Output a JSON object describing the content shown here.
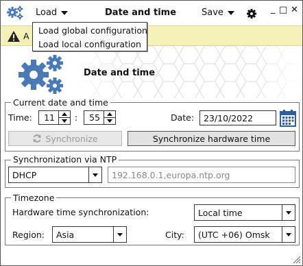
{
  "toolbar": {
    "load_label": "Load",
    "title": "Date and time",
    "save_label": "Save",
    "minimize": "_",
    "maximize": "□",
    "close": "✕"
  },
  "load_menu": {
    "items": [
      "Load global configuration",
      "Load local configuration"
    ]
  },
  "notification": {
    "visible_text": "A"
  },
  "banner": {
    "title": "Date and time"
  },
  "current": {
    "legend": "Current date and time",
    "time_label": "Time:",
    "hours": "11",
    "separator": ":",
    "minutes": "55",
    "date_label": "Date:",
    "date": "23/10/2022",
    "sync_label": "Synchronize",
    "sync_hw_label": "Synchronize hardware time"
  },
  "ntp": {
    "legend": "Synchronization via NTP",
    "mode": "DHCP",
    "servers": "192.168.0.1,europa.ntp.org"
  },
  "timezone": {
    "legend": "Timezone",
    "hw_sync_label": "Hardware time synchronization:",
    "hw_sync_value": "Local time",
    "region_label": "Region:",
    "region_value": "Asia",
    "city_label": "City:",
    "city_value": "(UTC +06) Omsk"
  },
  "colors": {
    "accent_icon": "#4a7ab5",
    "notification_bg": "#f4f0b8"
  },
  "icons": [
    "settings-gears-icon",
    "gear-icon",
    "warning-icon",
    "calendar-icon",
    "refresh-icon"
  ]
}
